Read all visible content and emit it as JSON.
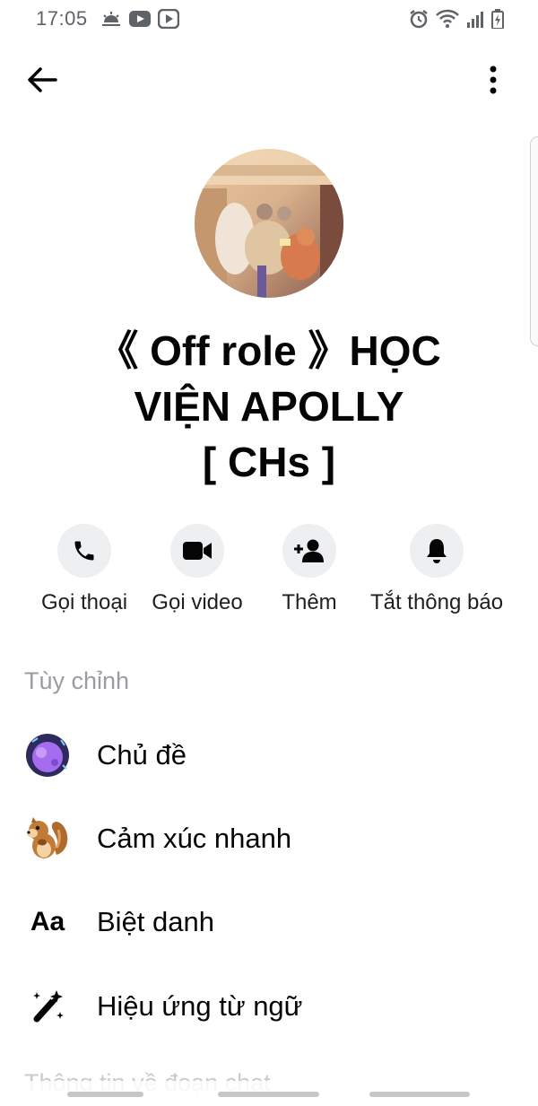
{
  "status_bar": {
    "time": "17:05",
    "left_icons": [
      "weather-icon",
      "youtube-icon",
      "video-app-icon"
    ],
    "right_icons": [
      "alarm-icon",
      "wifi-icon",
      "signal-icon",
      "battery-charging-icon"
    ]
  },
  "header": {
    "back_icon": "arrow-left-icon",
    "more_icon": "more-vertical-icon"
  },
  "group": {
    "name_line1": "《 Off role 》HỌC",
    "name_line2": "VIỆN APOLLY",
    "name_line3": "[ CHs ]"
  },
  "actions": [
    {
      "label": "Gọi thoại",
      "icon": "phone-icon"
    },
    {
      "label": "Gọi video",
      "icon": "video-camera-icon"
    },
    {
      "label": "Thêm",
      "icon": "add-person-icon"
    },
    {
      "label": "Tắt thông báo",
      "icon": "bell-icon"
    }
  ],
  "customize": {
    "header": "Tùy chỉnh",
    "items": [
      {
        "label": "Chủ đề",
        "icon": "theme-icon"
      },
      {
        "label": "Cảm xúc nhanh",
        "icon": "squirrel-emoji-icon"
      },
      {
        "label": "Biệt danh",
        "icon": "nickname-aa-icon",
        "glyph": "Aa"
      },
      {
        "label": "Hiệu ứng từ ngữ",
        "icon": "sparkle-wand-icon"
      }
    ]
  },
  "next_section_partial": "Thông tin về đoạn chat",
  "colors": {
    "action_bg": "#eeeff1",
    "section_header": "#9a9ca1",
    "theme_purple": "#a56cf0"
  }
}
